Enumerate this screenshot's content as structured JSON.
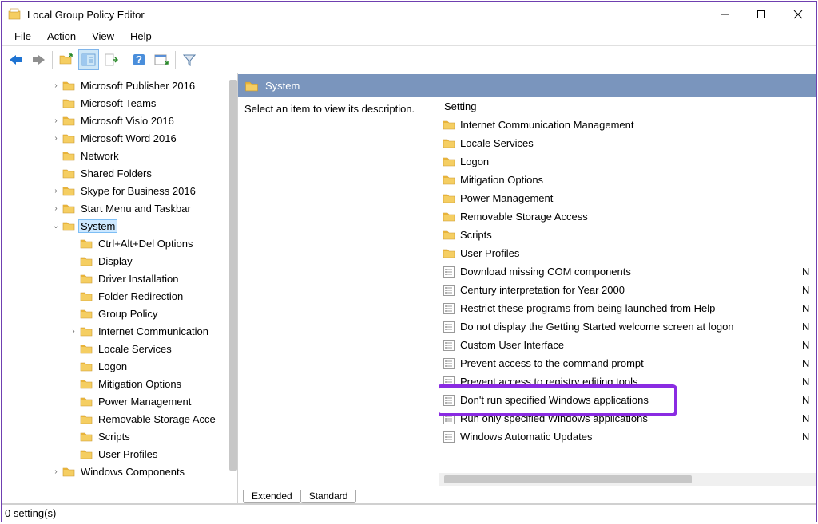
{
  "window": {
    "title": "Local Group Policy Editor"
  },
  "menus": [
    "File",
    "Action",
    "View",
    "Help"
  ],
  "tree": [
    {
      "indent": 1,
      "twisty": "›",
      "label": "Microsoft Publisher 2016"
    },
    {
      "indent": 1,
      "twisty": "",
      "label": "Microsoft Teams"
    },
    {
      "indent": 1,
      "twisty": "›",
      "label": "Microsoft Visio 2016"
    },
    {
      "indent": 1,
      "twisty": "›",
      "label": "Microsoft Word 2016"
    },
    {
      "indent": 1,
      "twisty": "",
      "label": "Network"
    },
    {
      "indent": 1,
      "twisty": "",
      "label": "Shared Folders"
    },
    {
      "indent": 1,
      "twisty": "›",
      "label": "Skype for Business 2016"
    },
    {
      "indent": 1,
      "twisty": "›",
      "label": "Start Menu and Taskbar"
    },
    {
      "indent": 1,
      "twisty": "v",
      "label": "System",
      "selected": true
    },
    {
      "indent": 2,
      "twisty": "",
      "label": "Ctrl+Alt+Del Options"
    },
    {
      "indent": 2,
      "twisty": "",
      "label": "Display"
    },
    {
      "indent": 2,
      "twisty": "",
      "label": "Driver Installation"
    },
    {
      "indent": 2,
      "twisty": "",
      "label": "Folder Redirection"
    },
    {
      "indent": 2,
      "twisty": "",
      "label": "Group Policy"
    },
    {
      "indent": 2,
      "twisty": "›",
      "label": "Internet Communication"
    },
    {
      "indent": 2,
      "twisty": "",
      "label": "Locale Services"
    },
    {
      "indent": 2,
      "twisty": "",
      "label": "Logon"
    },
    {
      "indent": 2,
      "twisty": "",
      "label": "Mitigation Options"
    },
    {
      "indent": 2,
      "twisty": "",
      "label": "Power Management"
    },
    {
      "indent": 2,
      "twisty": "",
      "label": "Removable Storage Acce"
    },
    {
      "indent": 2,
      "twisty": "",
      "label": "Scripts"
    },
    {
      "indent": 2,
      "twisty": "",
      "label": "User Profiles"
    },
    {
      "indent": 1,
      "twisty": "›",
      "label": "Windows Components"
    }
  ],
  "right": {
    "header": "System",
    "description": "Select an item to view its description.",
    "column_header": "Setting",
    "tabs": {
      "extended": "Extended",
      "standard": "Standard"
    }
  },
  "settings": [
    {
      "type": "folder",
      "label": "Internet Communication Management"
    },
    {
      "type": "folder",
      "label": "Locale Services"
    },
    {
      "type": "folder",
      "label": "Logon"
    },
    {
      "type": "folder",
      "label": "Mitigation Options"
    },
    {
      "type": "folder",
      "label": "Power Management"
    },
    {
      "type": "folder",
      "label": "Removable Storage Access"
    },
    {
      "type": "folder",
      "label": "Scripts"
    },
    {
      "type": "folder",
      "label": "User Profiles"
    },
    {
      "type": "setting",
      "label": "Download missing COM components",
      "state": "N"
    },
    {
      "type": "setting",
      "label": "Century interpretation for Year 2000",
      "state": "N"
    },
    {
      "type": "setting",
      "label": "Restrict these programs from being launched from Help",
      "state": "N"
    },
    {
      "type": "setting",
      "label": "Do not display the Getting Started welcome screen at logon",
      "state": "N"
    },
    {
      "type": "setting",
      "label": "Custom User Interface",
      "state": "N"
    },
    {
      "type": "setting",
      "label": "Prevent access to the command prompt",
      "state": "N"
    },
    {
      "type": "setting",
      "label": "Prevent access to registry editing tools",
      "state": "N"
    },
    {
      "type": "setting",
      "label": "Don't run specified Windows applications",
      "state": "N",
      "highlight": true
    },
    {
      "type": "setting",
      "label": "Run only specified Windows applications",
      "state": "N"
    },
    {
      "type": "setting",
      "label": "Windows Automatic Updates",
      "state": "N"
    }
  ],
  "status": "0 setting(s)"
}
